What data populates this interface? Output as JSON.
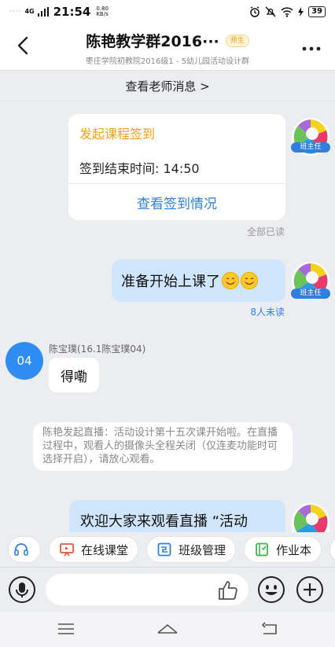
{
  "status_bar": {
    "network": "4G",
    "time": "21:54",
    "speed_value": "0.80",
    "speed_unit": "KB/s",
    "battery": "39"
  },
  "header": {
    "title": "陈艳教学群2016···",
    "badge": "师生",
    "subtitle": "枣庄学院初教院2016级1 - 5幼儿园活动设计群"
  },
  "teacher_messages_link": "查看老师消息 >",
  "messages": {
    "checkin_card": {
      "title": "发起课程签到",
      "end_time": "签到结束时间: 14:50",
      "link": "查看签到情况",
      "read_status": "全部已读",
      "avatar_tag": "班主任"
    },
    "msg_ready": {
      "text": "准备开始上课了",
      "unread": "8人未读",
      "avatar_tag": "班主任"
    },
    "msg_student": {
      "avatar_text": "04",
      "sender": "陈宝璞(16.1陈宝璞04)",
      "text": "得嘞"
    },
    "system_notice": "陈艳发起直播：活动设计第十五次课开始啦。在直播过程中，观看人的摄像头全程关闭（仅连麦功能时可选择开启），请放心观看。",
    "msg_welcome": {
      "text": "欢迎大家来观看直播 “活动"
    }
  },
  "toolbar": {
    "online_class": "在线课堂",
    "class_manage": "班级管理",
    "homework": "作业本"
  },
  "colors": {
    "accent_blue": "#2f7fdc",
    "checkin_orange": "#f0a21a",
    "my_bubble": "#cfe5fb"
  }
}
